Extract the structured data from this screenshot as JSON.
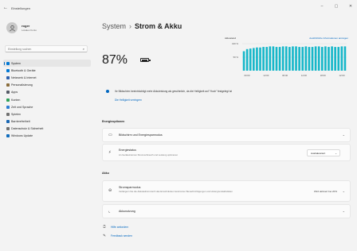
{
  "window": {
    "title": "Einstellungen",
    "controls": {
      "minimize": "–",
      "maximize": "▢",
      "close": "✕"
    }
  },
  "profile": {
    "name": "roger",
    "subtitle": "Lokales Konto"
  },
  "search": {
    "placeholder": "Einstellung suchen"
  },
  "sidebar": {
    "items": [
      {
        "label": "System",
        "icon": "system-icon",
        "color": "#0078d4",
        "active": true
      },
      {
        "label": "Bluetooth & Geräte",
        "icon": "bluetooth-icon",
        "color": "#0078d4"
      },
      {
        "label": "Netzwerk & Internet",
        "icon": "network-icon",
        "color": "#2b5fad"
      },
      {
        "label": "Personalisierung",
        "icon": "brush-icon",
        "color": "#8a6d3b"
      },
      {
        "label": "Apps",
        "icon": "apps-icon",
        "color": "#555a66"
      },
      {
        "label": "Konten",
        "icon": "account-icon",
        "color": "#2fa05a"
      },
      {
        "label": "Zeit und Sprache",
        "icon": "time-language-icon",
        "color": "#2b7cd3"
      },
      {
        "label": "Spielen",
        "icon": "gaming-icon",
        "color": "#707070"
      },
      {
        "label": "Barrierefreiheit",
        "icon": "accessibility-icon",
        "color": "#1a67b3"
      },
      {
        "label": "Datenschutz & Sicherheit",
        "icon": "shield-icon",
        "color": "#707070"
      },
      {
        "label": "Windows Update",
        "icon": "update-icon",
        "color": "#0f6cbd"
      }
    ]
  },
  "header": {
    "breadcrumb": "System",
    "separator": "›",
    "title": "Strom & Akku"
  },
  "battery": {
    "percent_label": "87%",
    "level": 0.87
  },
  "chart_label": "Akkustand",
  "chart_link": "Ausführliche Informationen anzeigen",
  "chart_data": {
    "type": "bar",
    "ylabel": "",
    "ylim": [
      0,
      100
    ],
    "y_ticks": [
      "100 %",
      "50 %"
    ],
    "x_ticks": [
      "00:00",
      "12:00",
      "06:00",
      "12:00",
      "18:00",
      "12:00"
    ],
    "values": [
      72,
      80,
      82,
      84,
      86,
      86,
      88,
      88,
      90,
      90,
      88,
      88,
      90,
      90,
      88,
      90,
      90,
      88,
      88,
      90,
      88,
      88,
      90,
      90,
      88,
      90,
      88,
      90,
      88,
      88,
      90,
      90
    ],
    "color": "#17b7c9"
  },
  "info": {
    "message": "Ihr Bildschirm beeinträchtigt mehr Akkuleistung als gewöhnlich, da die Helligkeit auf \"Hoch\" festgelegt ist",
    "link": "Die Helligkeit verringern"
  },
  "energy": {
    "heading": "Energieoptionen",
    "screen_sleep": {
      "title": "Bildschirm und Energiesparmodus"
    },
    "power_mode": {
      "title": "Energiestatus",
      "subtitle": "An Geräteinternen Stromverbrauch und Leistung optimieren",
      "value": "Ausbalanciert"
    }
  },
  "battery_section": {
    "heading": "Akku",
    "saver": {
      "title": "Stromsparmodus",
      "subtitle": "Verlängern Sie die Akkulaufzeit durch das Einschränken bestimmter Benachrichtigungen und Hintergrundaktivitäten",
      "value": "Wird aktiviert bei 20%"
    },
    "usage": {
      "title": "Akkunutzung"
    }
  },
  "help": {
    "get_help": "Hilfe anfordern",
    "feedback": "Feedback senden"
  }
}
